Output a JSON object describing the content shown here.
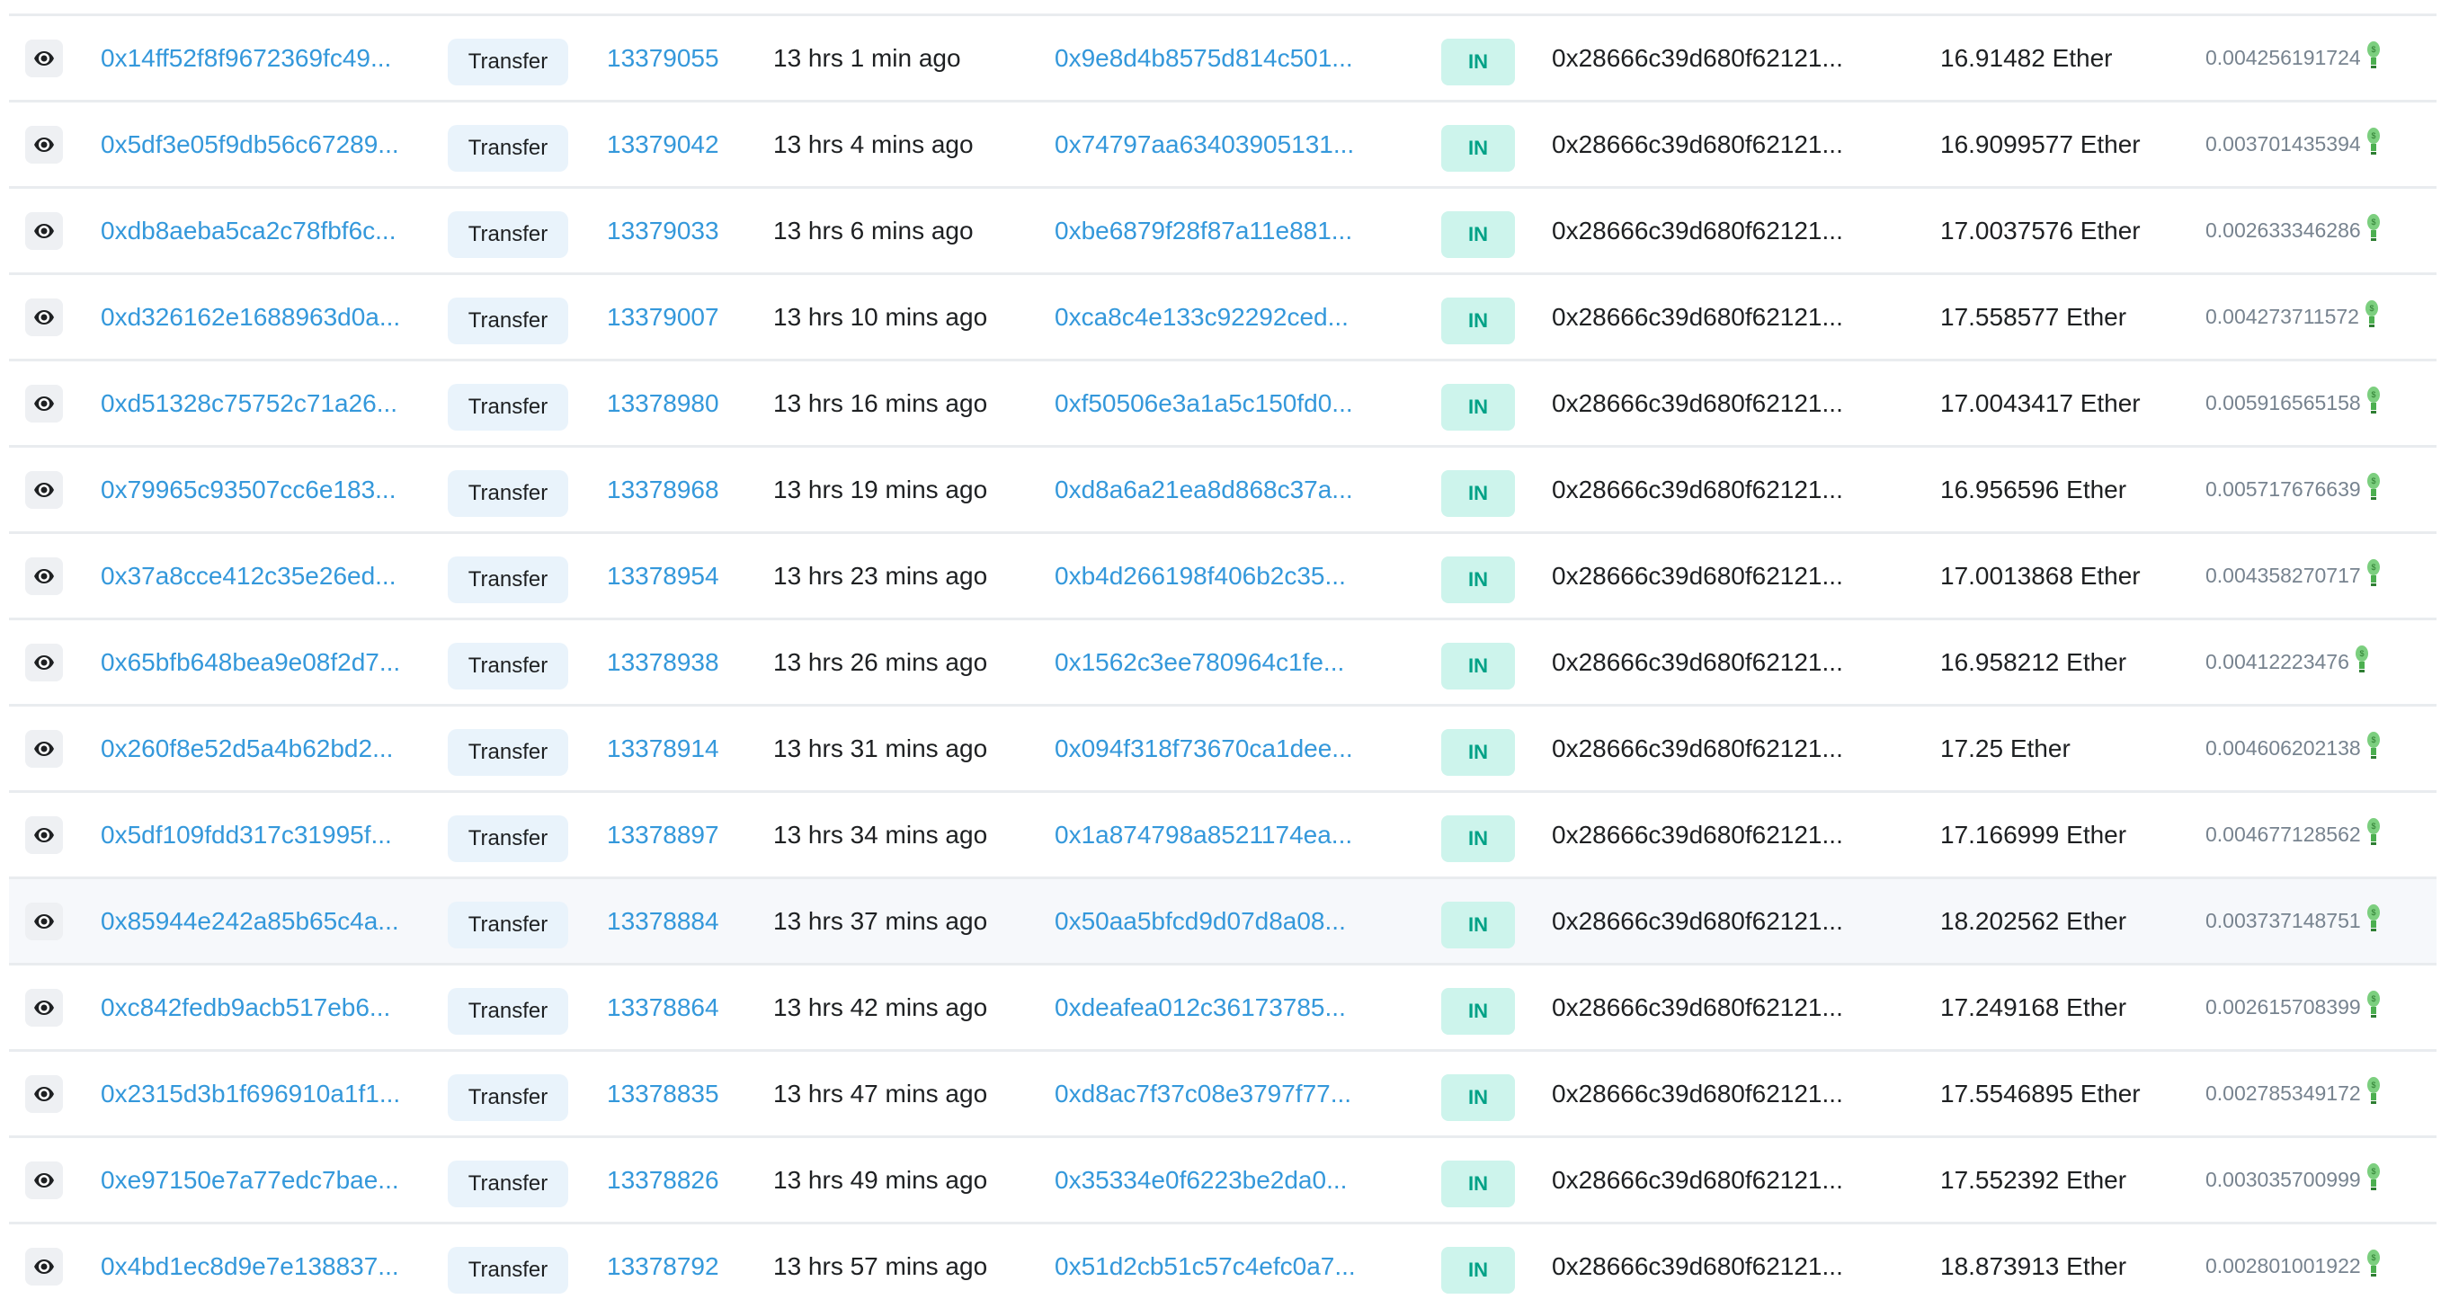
{
  "colors": {
    "link": "#3498db",
    "in_badge_bg": "#cdf4ec",
    "in_badge_text": "#00a186",
    "method_bg": "#e9f3fb",
    "fee_icon": "#4caf50"
  },
  "highlighted_row": 10,
  "rows": [
    {
      "hash": "0x14ff52f8f9672369fc49...",
      "method": "Transfer",
      "block": "13379055",
      "age": "13 hrs 1 min ago",
      "from": "0x9e8d4b8575d814c501...",
      "direction": "IN",
      "to": "0x28666c39d680f62121...",
      "value": "16.91482 Ether",
      "fee": "0.004256191724"
    },
    {
      "hash": "0x5df3e05f9db56c67289...",
      "method": "Transfer",
      "block": "13379042",
      "age": "13 hrs 4 mins ago",
      "from": "0x74797aa63403905131...",
      "direction": "IN",
      "to": "0x28666c39d680f62121...",
      "value": "16.9099577 Ether",
      "fee": "0.003701435394"
    },
    {
      "hash": "0xdb8aeba5ca2c78fbf6c...",
      "method": "Transfer",
      "block": "13379033",
      "age": "13 hrs 6 mins ago",
      "from": "0xbe6879f28f87a11e881...",
      "direction": "IN",
      "to": "0x28666c39d680f62121...",
      "value": "17.0037576 Ether",
      "fee": "0.002633346286"
    },
    {
      "hash": "0xd326162e1688963d0a...",
      "method": "Transfer",
      "block": "13379007",
      "age": "13 hrs 10 mins ago",
      "from": "0xca8c4e133c92292ced...",
      "direction": "IN",
      "to": "0x28666c39d680f62121...",
      "value": "17.558577 Ether",
      "fee": "0.004273711572"
    },
    {
      "hash": "0xd51328c75752c71a26...",
      "method": "Transfer",
      "block": "13378980",
      "age": "13 hrs 16 mins ago",
      "from": "0xf50506e3a1a5c150fd0...",
      "direction": "IN",
      "to": "0x28666c39d680f62121...",
      "value": "17.0043417 Ether",
      "fee": "0.005916565158"
    },
    {
      "hash": "0x79965c93507cc6e183...",
      "method": "Transfer",
      "block": "13378968",
      "age": "13 hrs 19 mins ago",
      "from": "0xd8a6a21ea8d868c37a...",
      "direction": "IN",
      "to": "0x28666c39d680f62121...",
      "value": "16.956596 Ether",
      "fee": "0.005717676639"
    },
    {
      "hash": "0x37a8cce412c35e26ed...",
      "method": "Transfer",
      "block": "13378954",
      "age": "13 hrs 23 mins ago",
      "from": "0xb4d266198f406b2c35...",
      "direction": "IN",
      "to": "0x28666c39d680f62121...",
      "value": "17.0013868 Ether",
      "fee": "0.004358270717"
    },
    {
      "hash": "0x65bfb648bea9e08f2d7...",
      "method": "Transfer",
      "block": "13378938",
      "age": "13 hrs 26 mins ago",
      "from": "0x1562c3ee780964c1fe...",
      "direction": "IN",
      "to": "0x28666c39d680f62121...",
      "value": "16.958212 Ether",
      "fee": "0.00412223476"
    },
    {
      "hash": "0x260f8e52d5a4b62bd2...",
      "method": "Transfer",
      "block": "13378914",
      "age": "13 hrs 31 mins ago",
      "from": "0x094f318f73670ca1dee...",
      "direction": "IN",
      "to": "0x28666c39d680f62121...",
      "value": "17.25 Ether",
      "fee": "0.004606202138"
    },
    {
      "hash": "0x5df109fdd317c31995f...",
      "method": "Transfer",
      "block": "13378897",
      "age": "13 hrs 34 mins ago",
      "from": "0x1a874798a8521174ea...",
      "direction": "IN",
      "to": "0x28666c39d680f62121...",
      "value": "17.166999 Ether",
      "fee": "0.004677128562"
    },
    {
      "hash": "0x85944e242a85b65c4a...",
      "method": "Transfer",
      "block": "13378884",
      "age": "13 hrs 37 mins ago",
      "from": "0x50aa5bfcd9d07d8a08...",
      "direction": "IN",
      "to": "0x28666c39d680f62121...",
      "value": "18.202562 Ether",
      "fee": "0.003737148751"
    },
    {
      "hash": "0xc842fedb9acb517eb6...",
      "method": "Transfer",
      "block": "13378864",
      "age": "13 hrs 42 mins ago",
      "from": "0xdeafea012c36173785...",
      "direction": "IN",
      "to": "0x28666c39d680f62121...",
      "value": "17.249168 Ether",
      "fee": "0.002615708399"
    },
    {
      "hash": "0x2315d3b1f696910a1f1...",
      "method": "Transfer",
      "block": "13378835",
      "age": "13 hrs 47 mins ago",
      "from": "0xd8ac7f37c08e3797f77...",
      "direction": "IN",
      "to": "0x28666c39d680f62121...",
      "value": "17.5546895 Ether",
      "fee": "0.002785349172"
    },
    {
      "hash": "0xe97150e7a77edc7bae...",
      "method": "Transfer",
      "block": "13378826",
      "age": "13 hrs 49 mins ago",
      "from": "0x35334e0f6223be2da0...",
      "direction": "IN",
      "to": "0x28666c39d680f62121...",
      "value": "17.552392 Ether",
      "fee": "0.003035700999"
    },
    {
      "hash": "0x4bd1ec8d9e7e138837...",
      "method": "Transfer",
      "block": "13378792",
      "age": "13 hrs 57 mins ago",
      "from": "0x51d2cb51c57c4efc0a7...",
      "direction": "IN",
      "to": "0x28666c39d680f62121...",
      "value": "18.873913 Ether",
      "fee": "0.002801001922"
    }
  ]
}
